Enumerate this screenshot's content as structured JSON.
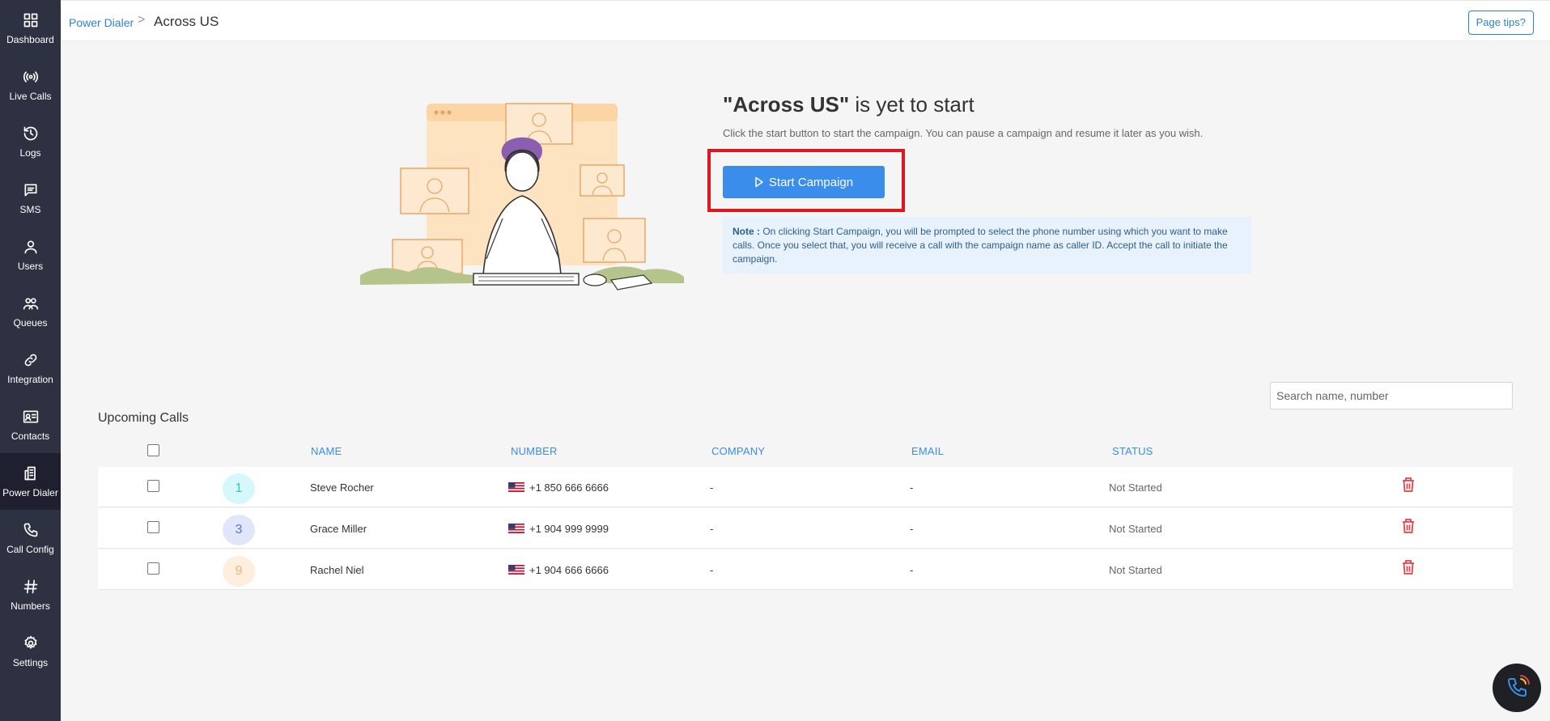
{
  "sidebar": {
    "items": [
      {
        "label": "Dashboard",
        "icon": "grid-icon"
      },
      {
        "label": "Live Calls",
        "icon": "broadcast-icon"
      },
      {
        "label": "Logs",
        "icon": "history-icon"
      },
      {
        "label": "SMS",
        "icon": "message-icon"
      },
      {
        "label": "Users",
        "icon": "user-icon"
      },
      {
        "label": "Queues",
        "icon": "users-group-icon"
      },
      {
        "label": "Integration",
        "icon": "link-icon"
      },
      {
        "label": "Contacts",
        "icon": "contact-card-icon"
      },
      {
        "label": "Power Dialer",
        "icon": "phone-building-icon",
        "active": true
      },
      {
        "label": "Call Config",
        "icon": "phone-icon"
      },
      {
        "label": "Numbers",
        "icon": "hash-icon"
      },
      {
        "label": "Settings",
        "icon": "gear-icon"
      }
    ]
  },
  "header": {
    "breadcrumb_parent": "Power Dialer",
    "breadcrumb_separator": ">",
    "breadcrumb_current": "Across US",
    "page_tips_label": "Page tips?"
  },
  "hero": {
    "title_name": "\"Across US\"",
    "title_rest": " is yet to start",
    "subtitle": "Click the start button to start the campaign. You can pause a campaign and resume it later as you wish.",
    "start_button_label": "Start Campaign",
    "note_label": "Note :",
    "note_text": " On clicking Start Campaign, you will be prompted to select the phone number using which you want to make calls. Once you select that, you will receive a call with the campaign name as caller ID. Accept the call to initiate the campaign."
  },
  "upcoming": {
    "title": "Upcoming Calls",
    "search_placeholder": "Search name, number",
    "columns": [
      "NAME",
      "NUMBER",
      "COMPANY",
      "EMAIL",
      "STATUS"
    ],
    "rows": [
      {
        "avatar": "1",
        "name": "Steve Rocher",
        "number": "+1 850 666 6666",
        "company": "-",
        "email": "-",
        "status": "Not Started",
        "avatar_bg": "#d7f8fa",
        "avatar_fg": "#38c3cc"
      },
      {
        "avatar": "3",
        "name": "Grace Miller",
        "number": "+1 904 999 9999",
        "company": "-",
        "email": "-",
        "status": "Not Started",
        "avatar_bg": "#e1e7fb",
        "avatar_fg": "#5c76d6"
      },
      {
        "avatar": "9",
        "name": "Rachel Niel",
        "number": "+1 904 666 6666",
        "company": "-",
        "email": "-",
        "status": "Not Started",
        "avatar_bg": "#fdeede",
        "avatar_fg": "#f0b27a"
      }
    ]
  },
  "colors": {
    "sidebar_bg": "#2e3142",
    "accent": "#3a8dea",
    "highlight": "#e0161e",
    "delete": "#e0454b"
  }
}
